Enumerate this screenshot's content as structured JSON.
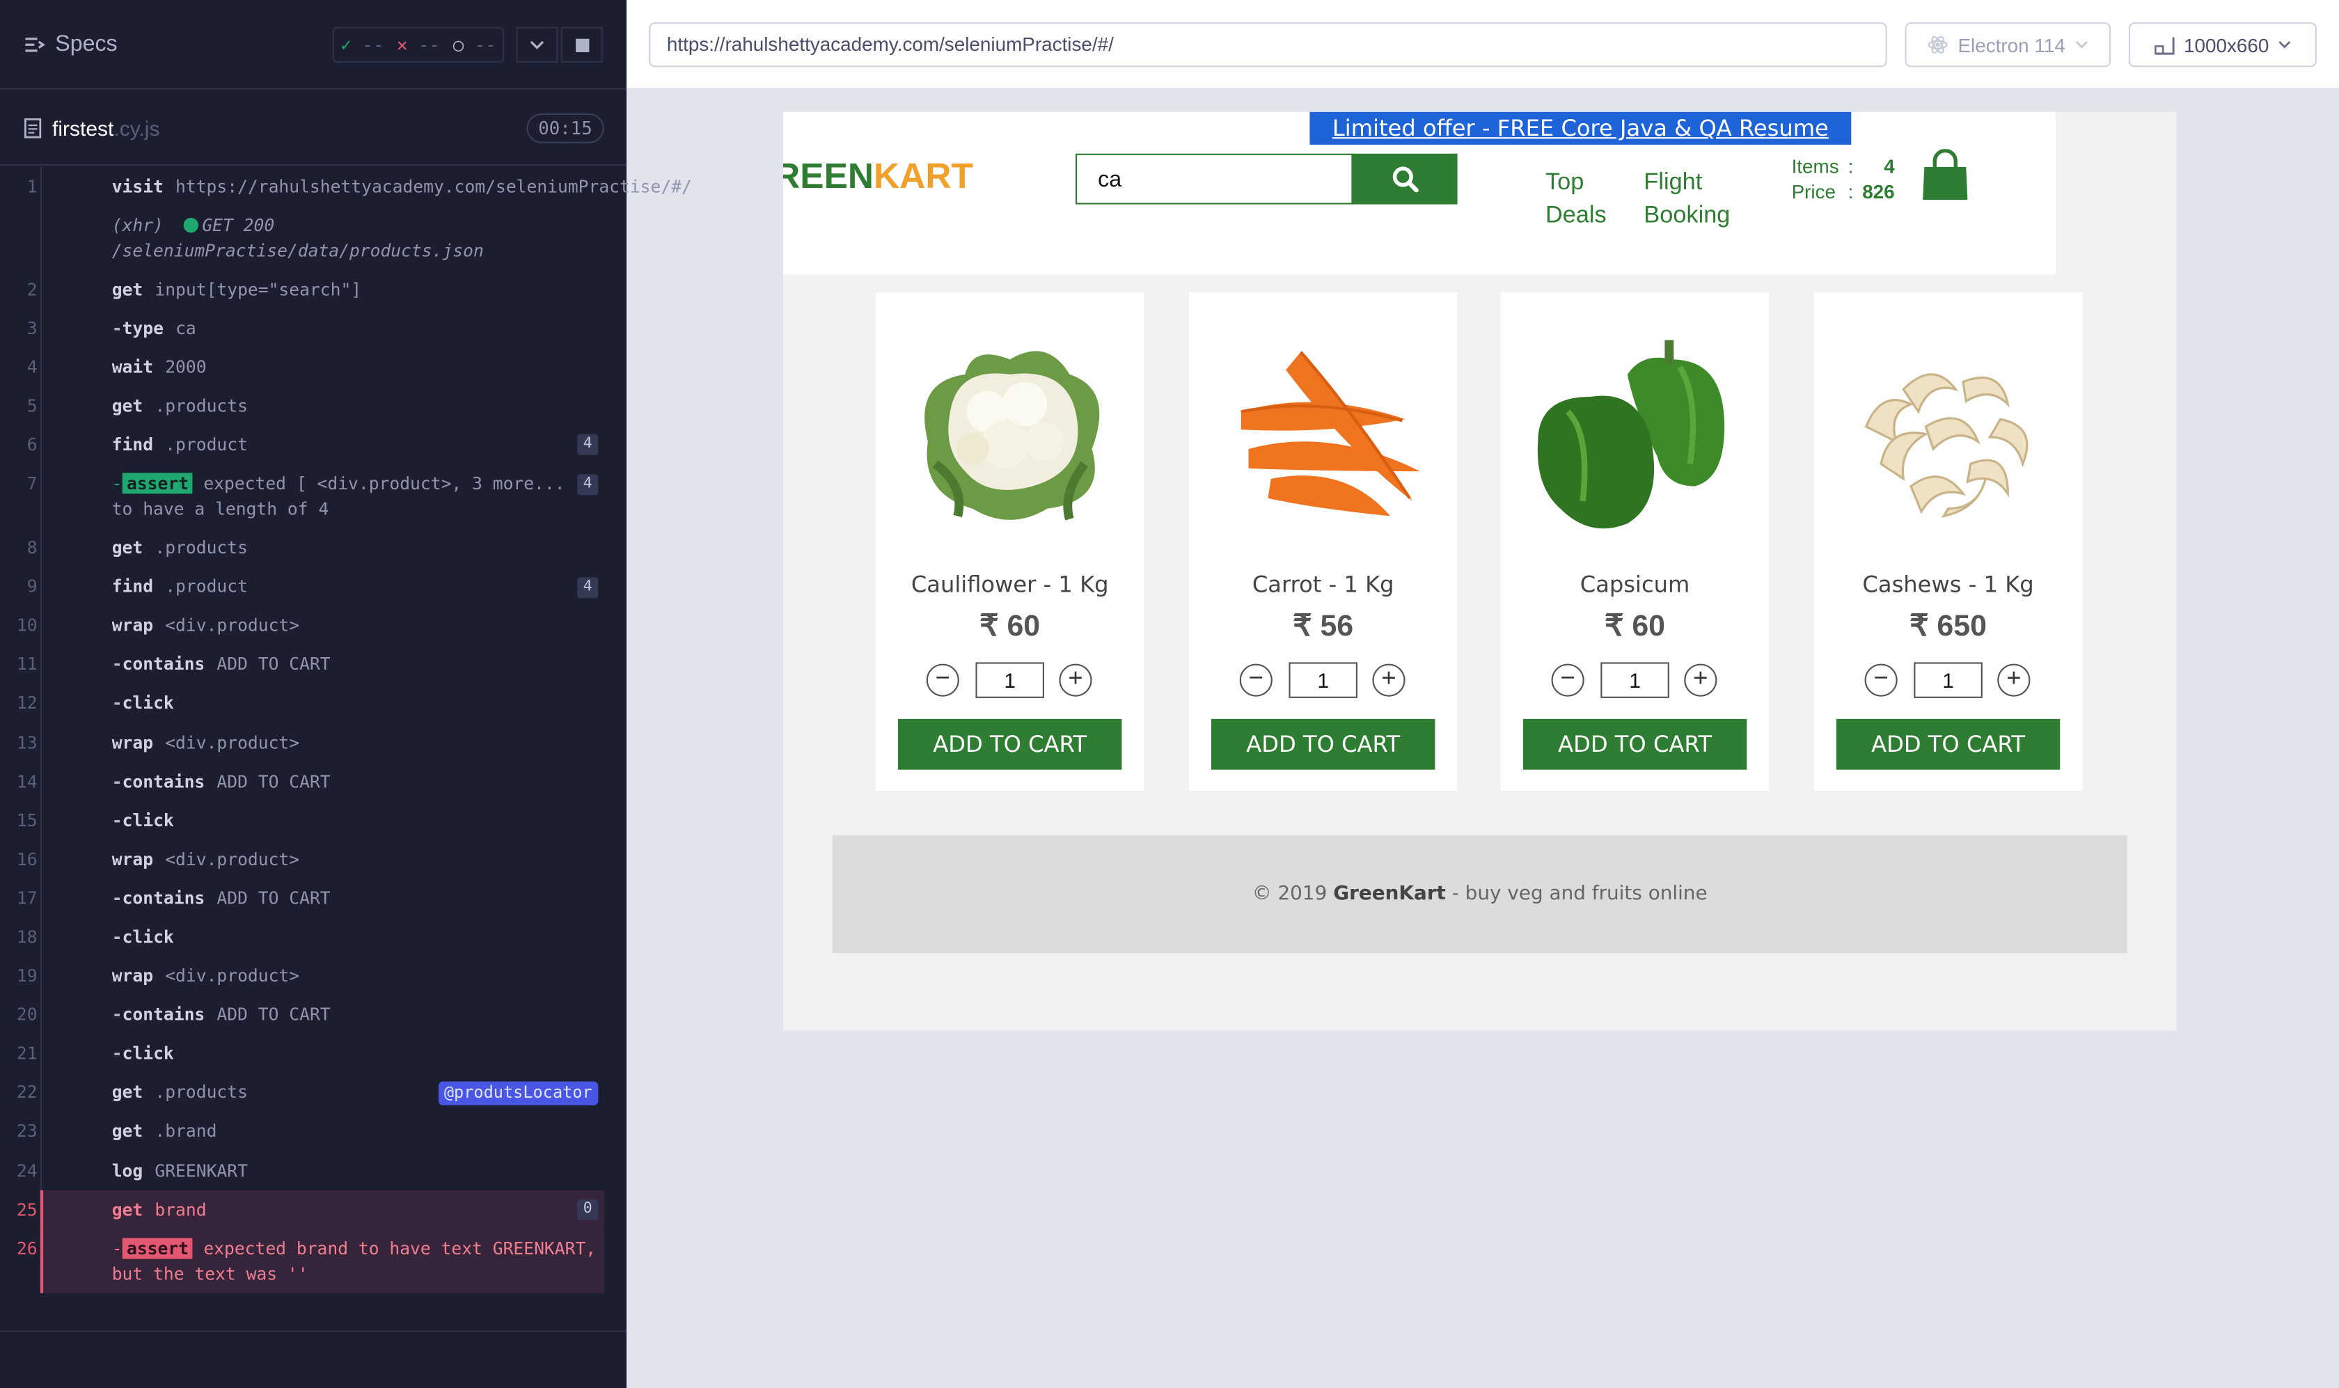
{
  "sidebar": {
    "specs_label": "Specs",
    "stats": {
      "passed": "--",
      "failed": "--",
      "pending": "--"
    },
    "file": {
      "name": "firstest",
      "ext": ".cy.js",
      "duration": "00:15"
    },
    "commands": [
      {
        "n": "1",
        "name": "visit",
        "msg": "https://rahulshettyacademy.com/seleniumPractise/#/"
      },
      {
        "n": "",
        "xhr": "(xhr)",
        "xhr_msg": "GET 200 /seleniumPractise/data/products.json"
      },
      {
        "n": "2",
        "name": "get",
        "msg": "input[type=\"search\"]"
      },
      {
        "n": "3",
        "name": "type",
        "msg": "ca",
        "child": true
      },
      {
        "n": "4",
        "name": "wait",
        "msg": "2000"
      },
      {
        "n": "5",
        "name": "get",
        "msg": ".products"
      },
      {
        "n": "6",
        "name": "find",
        "msg": ".product",
        "badge": "4"
      },
      {
        "n": "7",
        "assert": true,
        "assert_label": "assert",
        "msg": "expected [ <div.product>, 3 more... ] to have a length of 4",
        "badge": "4"
      },
      {
        "n": "8",
        "name": "get",
        "msg": ".products"
      },
      {
        "n": "9",
        "name": "find",
        "msg": ".product",
        "badge": "4"
      },
      {
        "n": "10",
        "name": "wrap",
        "msg": "<div.product>"
      },
      {
        "n": "11",
        "name": "contains",
        "msg": "ADD TO CART",
        "child": true
      },
      {
        "n": "12",
        "name": "click",
        "msg": "",
        "child": true
      },
      {
        "n": "13",
        "name": "wrap",
        "msg": "<div.product>"
      },
      {
        "n": "14",
        "name": "contains",
        "msg": "ADD TO CART",
        "child": true
      },
      {
        "n": "15",
        "name": "click",
        "msg": "",
        "child": true
      },
      {
        "n": "16",
        "name": "wrap",
        "msg": "<div.product>"
      },
      {
        "n": "17",
        "name": "contains",
        "msg": "ADD TO CART",
        "child": true
      },
      {
        "n": "18",
        "name": "click",
        "msg": "",
        "child": true
      },
      {
        "n": "19",
        "name": "wrap",
        "msg": "<div.product>"
      },
      {
        "n": "20",
        "name": "contains",
        "msg": "ADD TO CART",
        "child": true
      },
      {
        "n": "21",
        "name": "click",
        "msg": "",
        "child": true
      },
      {
        "n": "22",
        "name": "get",
        "msg": ".products",
        "alias": "@produtsLocator"
      },
      {
        "n": "23",
        "name": "get",
        "msg": ".brand"
      },
      {
        "n": "24",
        "name": "log",
        "msg": "GREENKART"
      },
      {
        "n": "25",
        "name": "get",
        "msg": "brand",
        "badge": "0",
        "fail": true
      },
      {
        "n": "26",
        "assert": true,
        "assert_label": "assert",
        "msg": "expected brand to have text GREENKART, but the text was ''",
        "fail": true
      }
    ]
  },
  "header": {
    "url": "https://rahulshettyacademy.com/seleniumPractise/#/",
    "browser": "Electron 114",
    "viewport": "1000x660"
  },
  "app": {
    "offer": "Limited offer - FREE Core Java & QA Resume course",
    "brand_green": "REEN",
    "brand_orange": "KART",
    "search_value": "ca",
    "nav": {
      "top_deals_1": "Top",
      "top_deals_2": "Deals",
      "flight_1": "Flight",
      "flight_2": "Booking"
    },
    "cart": {
      "items_label": "Items",
      "items_value": "4",
      "price_label": "Price",
      "price_value": "826"
    },
    "products": [
      {
        "name": "Cauliflower - 1 Kg",
        "price": "₹ 60",
        "qty": "1",
        "button": "ADD TO CART",
        "img": "cauliflower"
      },
      {
        "name": "Carrot - 1 Kg",
        "price": "₹ 56",
        "qty": "1",
        "button": "ADD TO CART",
        "img": "carrot"
      },
      {
        "name": "Capsicum",
        "price": "₹ 60",
        "qty": "1",
        "button": "ADD TO CART",
        "img": "capsicum"
      },
      {
        "name": "Cashews - 1 Kg",
        "price": "₹ 650",
        "qty": "1",
        "button": "ADD TO CART",
        "img": "cashews"
      }
    ],
    "footer": {
      "prefix": "© 2019 ",
      "brand": "GreenKart",
      "suffix": " - buy veg and fruits online"
    },
    "colors": {
      "green": "#2e7d32",
      "orange": "#f0a12b",
      "offer_blue": "#1e63d7"
    }
  }
}
